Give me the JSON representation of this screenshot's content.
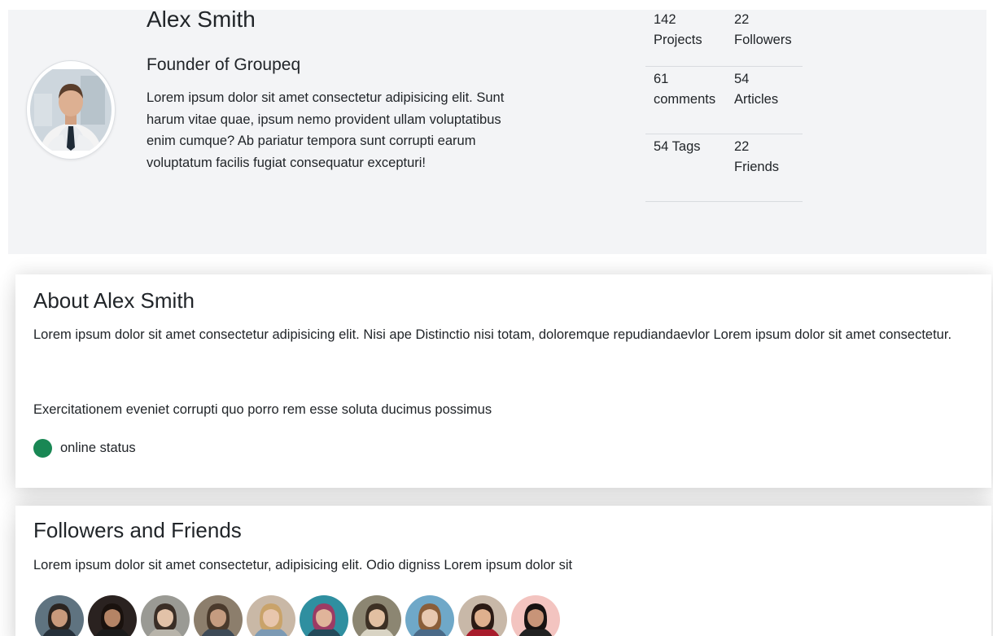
{
  "profile": {
    "name": "Alex Smith",
    "role": "Founder of Groupeq",
    "bio": "Lorem ipsum dolor sit amet consectetur adipisicing elit. Sunt harum vitae quae, ipsum nemo provident ullam voluptatibus enim cumque? Ab pariatur tempora sunt corrupti earum voluptatum facilis fugiat consequatur excepturi!",
    "avatar_icon": "person-avatar"
  },
  "stats": [
    {
      "a_value": "142",
      "a_label": "Projects",
      "b_value": "22",
      "b_label": "Followers"
    },
    {
      "a_value": "61",
      "a_label": "comments",
      "b_value": "54",
      "b_label": "Articles"
    },
    {
      "a_value": "54 Tags",
      "a_label": "",
      "b_value": "22",
      "b_label": "Friends"
    }
  ],
  "about": {
    "title": "About Alex Smith",
    "paragraph1": "Lorem ipsum dolor sit amet consectetur adipisicing elit. Nisi ape Distinctio nisi totam, doloremque repudiandaevlor Lorem ipsum dolor sit amet consectetur.",
    "paragraph2": "Exercitationem eveniet corrupti quo porro rem esse soluta ducimus possimus",
    "status_label": "online status",
    "status_color": "#198754"
  },
  "followers": {
    "title": "Followers and Friends",
    "description": "Lorem ipsum dolor sit amet consectetur, adipisicing elit. Odio digniss Lorem ipsum dolor sit",
    "avatars": [
      {
        "bg": "#5f7380",
        "skin": "#c99a7c",
        "hair": "#2b2420",
        "shirt": "#26303a"
      },
      {
        "bg": "#2a2220",
        "skin": "#b58465",
        "hair": "#1a120e",
        "shirt": "#1b1b1b"
      },
      {
        "bg": "#9a9a94",
        "skin": "#e2c2a8",
        "hair": "#3a2e26",
        "shirt": "#b8b4aa"
      },
      {
        "bg": "#8c7e6c",
        "skin": "#c59c80",
        "hair": "#4a3a2c",
        "shirt": "#3d4a56"
      },
      {
        "bg": "#c9b8a6",
        "skin": "#e8c6ad",
        "hair": "#c9a36a",
        "shirt": "#7c9ab4"
      },
      {
        "bg": "#2f8fa0",
        "skin": "#e0b49a",
        "hair": "#9c3b64",
        "shirt": "#244a5a"
      },
      {
        "bg": "#8c8672",
        "skin": "#e2c0a2",
        "hair": "#3c3024",
        "shirt": "#d9d4c4"
      },
      {
        "bg": "#6fa8c8",
        "skin": "#e8c8b0",
        "hair": "#8a5e3a",
        "shirt": "#4a6a88"
      },
      {
        "bg": "#c8b8a8",
        "skin": "#dfb08e",
        "hair": "#2b1a14",
        "shirt": "#a81c2c"
      },
      {
        "bg": "#f3c4c0",
        "skin": "#c89478",
        "hair": "#171212",
        "shirt": "#222222"
      }
    ]
  }
}
